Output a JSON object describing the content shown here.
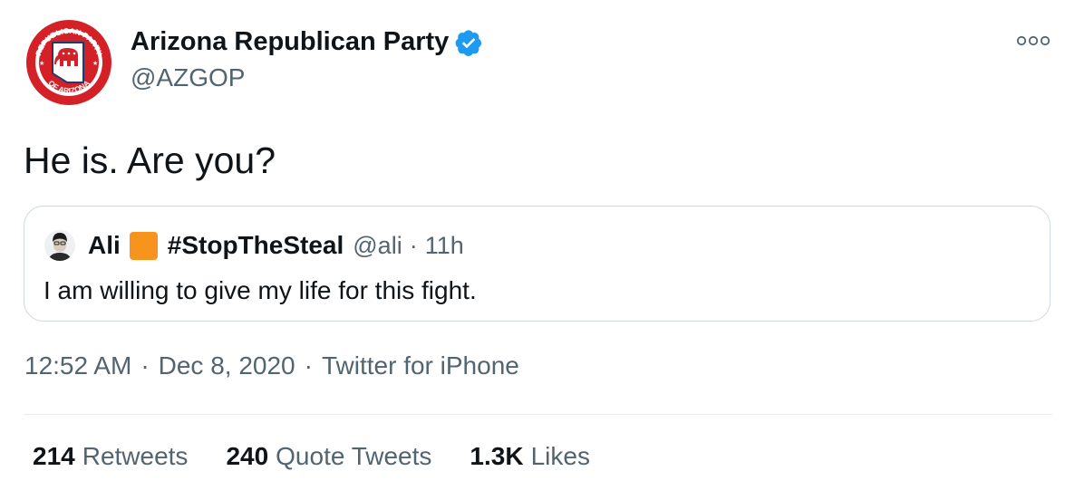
{
  "author": {
    "name": "Arizona Republican Party",
    "handle": "@AZGOP",
    "logo_text_top": "REPUBLICAN PARTY",
    "logo_text_bottom": "OF ARIZONA",
    "verified": true
  },
  "tweet": {
    "text": "He is. Are you?"
  },
  "quoted_tweet": {
    "name": "Ali",
    "hashtag": "#StopTheSteal",
    "handle": "@ali",
    "sep": "·",
    "time": "11h",
    "text": "I am willing to give my life for this fight."
  },
  "meta": {
    "time": "12:52 AM",
    "sep1": "·",
    "date": "Dec 8, 2020",
    "sep2": "·",
    "source": "Twitter for iPhone"
  },
  "stats": [
    {
      "count": "214",
      "label": "Retweets"
    },
    {
      "count": "240",
      "label": "Quote Tweets"
    },
    {
      "count": "1.3K",
      "label": "Likes"
    }
  ],
  "colors": {
    "verified_blue": "#1d9bf0",
    "secondary_text": "#536471",
    "logo_red": "#d42027",
    "logo_blue": "#1c3b6e",
    "emoji_orange": "#f7941d"
  },
  "icons": [
    "verified-badge-icon",
    "more-options-icon"
  ]
}
